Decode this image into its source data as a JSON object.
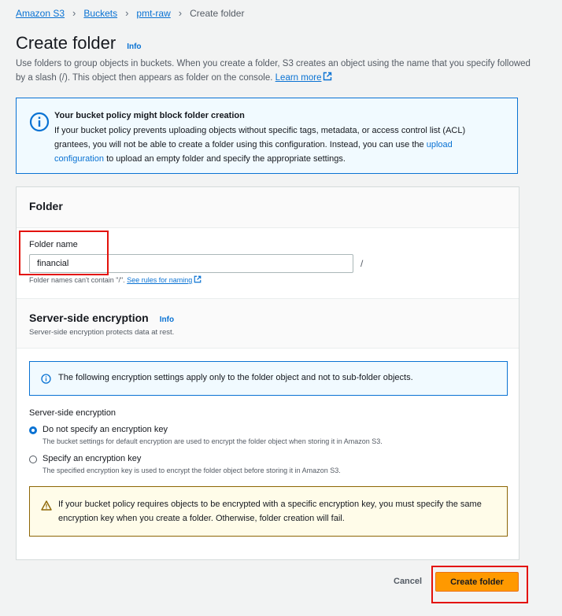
{
  "breadcrumb": {
    "items": [
      "Amazon S3",
      "Buckets",
      "pmt-raw"
    ],
    "current": "Create folder"
  },
  "page": {
    "title": "Create folder",
    "info": "Info",
    "description": "Use folders to group objects in buckets. When you create a folder, S3 creates an object using the name that you specify followed by a slash (/). This object then appears as folder on the console.",
    "learn_more": "Learn more"
  },
  "policy_alert": {
    "title": "Your bucket policy might block folder creation",
    "body_before_link": "If your bucket policy prevents uploading objects without specific tags, metadata, or access control list (ACL) grantees, you will not be able to create a folder using this configuration. Instead, you can use the",
    "link": "upload configuration",
    "body_after_link": "to upload an empty folder and specify the appropriate settings."
  },
  "folder_section": {
    "heading": "Folder",
    "name_label": "Folder name",
    "name_value": "financial",
    "suffix": "/",
    "hint": "Folder names can't contain \"/\".",
    "hint_link": "See rules for naming"
  },
  "encryption_section": {
    "heading": "Server-side encryption",
    "info": "Info",
    "subtitle": "Server-side encryption protects data at rest.",
    "notice": "The following encryption settings apply only to the folder object and not to sub-folder objects.",
    "group_label": "Server-side encryption",
    "options": [
      {
        "label": "Do not specify an encryption key",
        "description": "The bucket settings for default encryption are used to encrypt the folder object when storing it in Amazon S3.",
        "selected": true
      },
      {
        "label": "Specify an encryption key",
        "description": "The specified encryption key is used to encrypt the folder object before storing it in Amazon S3.",
        "selected": false
      }
    ],
    "warning": "If your bucket policy requires objects to be encrypted with a specific encryption key, you must specify the same encryption key when you create a folder. Otherwise, folder creation will fail."
  },
  "actions": {
    "cancel": "Cancel",
    "create": "Create folder"
  },
  "colors": {
    "accent": "#0972d3",
    "primary_button": "#ff9900",
    "annotation": "#e3120b"
  }
}
